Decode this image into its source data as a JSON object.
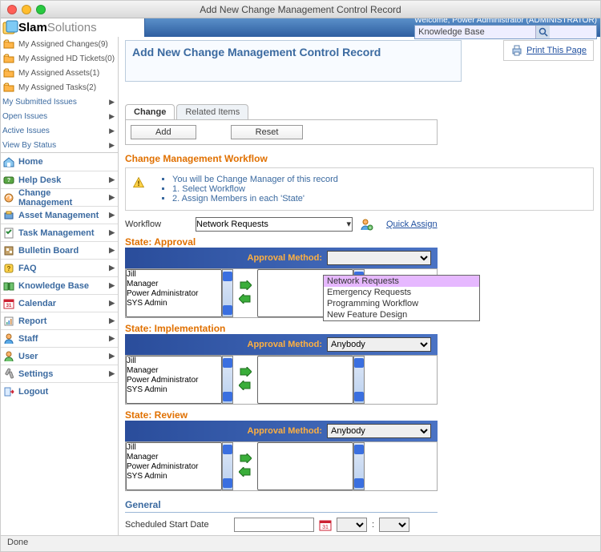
{
  "window_title": "Add New Change Management Control Record",
  "welcome": "Welcome, Power Administrator (ADMINISTRATOR)",
  "search_placeholder": "Knowledge Base",
  "page_title": "Add New Change Management Control Record",
  "print_label": "Print This Page",
  "sidebar_assigned": [
    "My Assigned Changes(9)",
    "My Assigned HD Tickets(0)",
    "My Assigned Assets(1)",
    "My Assigned Tasks(2)"
  ],
  "sidebar_text_links": [
    "My Submitted Issues",
    "Open Issues",
    "Active Issues",
    "View By Status"
  ],
  "sidebar_modules": [
    {
      "label": "Home",
      "icon": "home",
      "arrow": false
    },
    {
      "label": "Help Desk",
      "icon": "helpdesk",
      "arrow": true
    },
    {
      "label": "Change Management",
      "icon": "change",
      "arrow": true
    },
    {
      "label": "Asset Management",
      "icon": "asset",
      "arrow": true
    },
    {
      "label": "Task Management",
      "icon": "task",
      "arrow": true
    },
    {
      "label": "Bulletin Board",
      "icon": "board",
      "arrow": true
    },
    {
      "label": "FAQ",
      "icon": "faq",
      "arrow": true
    },
    {
      "label": "Knowledge Base",
      "icon": "kb",
      "arrow": true
    },
    {
      "label": "Calendar",
      "icon": "calendar",
      "arrow": true
    },
    {
      "label": "Report",
      "icon": "report",
      "arrow": true
    },
    {
      "label": "Staff",
      "icon": "staff",
      "arrow": true
    },
    {
      "label": "User",
      "icon": "user",
      "arrow": true
    },
    {
      "label": "Settings",
      "icon": "settings",
      "arrow": true
    },
    {
      "label": "Logout",
      "icon": "logout",
      "arrow": false
    }
  ],
  "tabs": {
    "active": "Change",
    "other": "Related Items"
  },
  "buttons": {
    "add": "Add",
    "reset": "Reset"
  },
  "workflow_section_title": "Change Management Workflow",
  "info_lines": [
    "You will be Change Manager of this record",
    "1. Select Workflow",
    "2. Assign Members in each 'State'"
  ],
  "workflow_label": "Workflow",
  "workflow_selected": "Network Requests",
  "workflow_options": [
    "Network Requests",
    "Emergency Requests",
    "Programming Workflow",
    "New Feature Design"
  ],
  "quick_assign": "Quick Assign",
  "approval_method_label": "Approval Method:",
  "approval_method_value": "Anybody",
  "members": [
    "Jill",
    "Manager",
    "Power Administrator",
    "SYS Admin"
  ],
  "states": {
    "approval": "State: Approval",
    "implementation": "State: Implementation",
    "review": "State: Review"
  },
  "general_title": "General",
  "sched_label": "Scheduled Start Date",
  "time_sep": ":",
  "status_text": "Done"
}
